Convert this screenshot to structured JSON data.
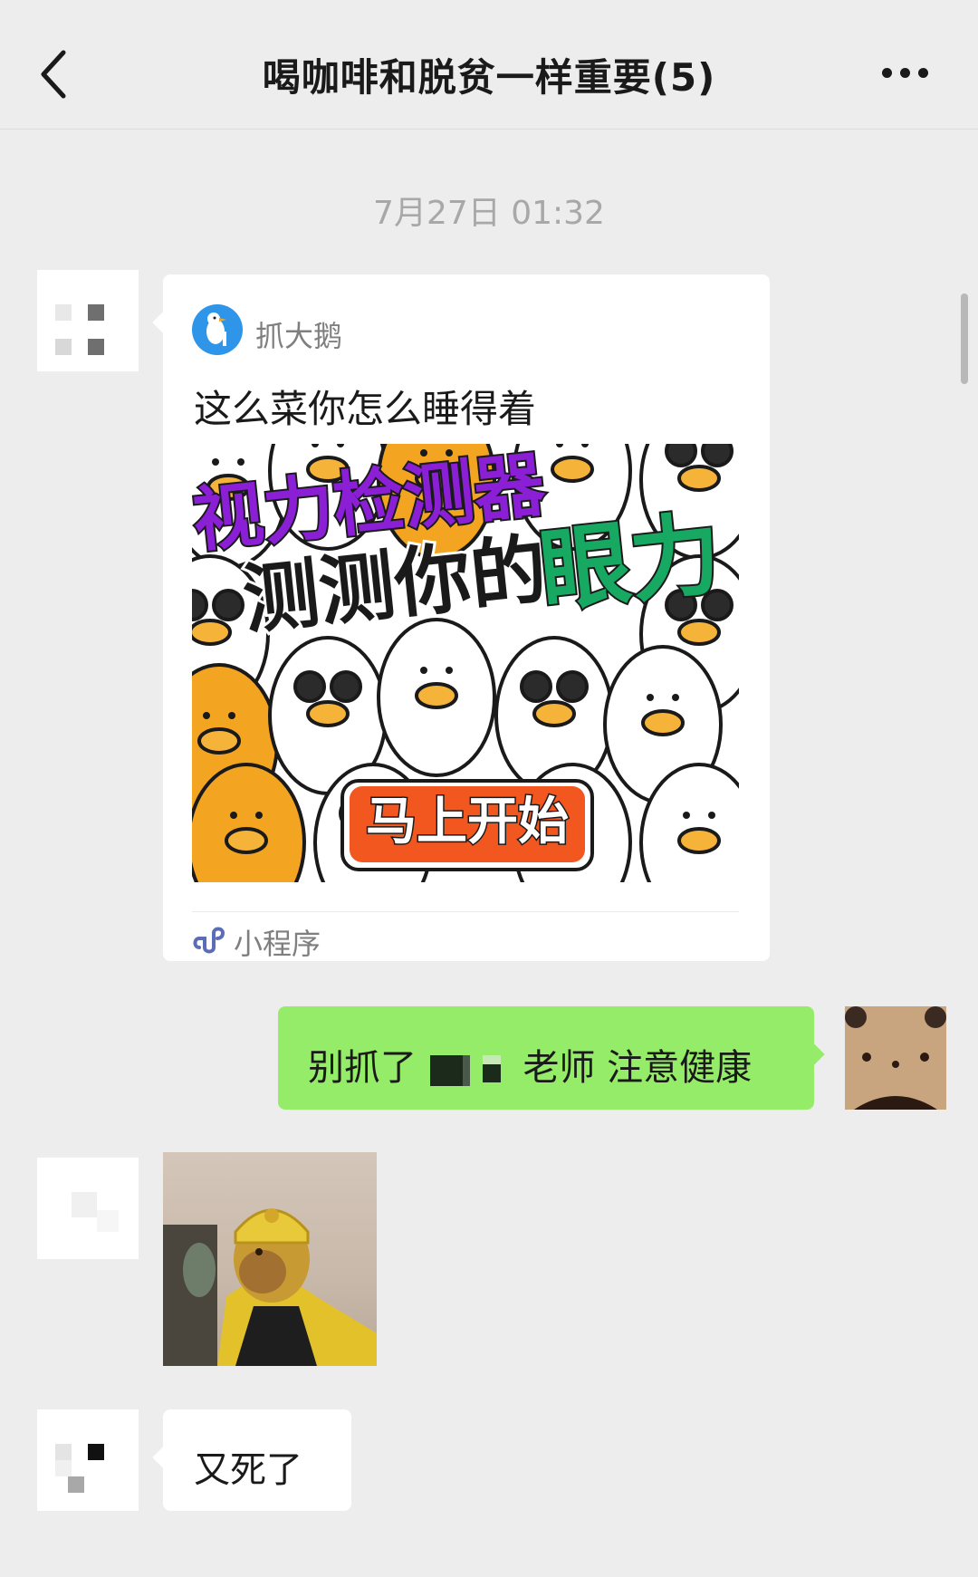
{
  "header": {
    "title": "喝咖啡和脱贫一样重要(5)",
    "back_icon": "chevron-left-icon",
    "more_icon": "ellipsis-icon"
  },
  "timestamp": "7月27日 01:32",
  "messages": [
    {
      "type": "mini_program",
      "sender": "other",
      "app_name": "抓大鹅",
      "description": "这么菜你怎么睡得着",
      "image": {
        "headline_1": "视力检测器",
        "headline_2": "测测你的",
        "headline_3": "眼力",
        "cta": "马上开始"
      },
      "footer_label": "小程序",
      "footer_icon": "mini-program-icon"
    },
    {
      "type": "text",
      "sender": "me",
      "text_before": "别抓了",
      "text_after": "老师 注意健康"
    },
    {
      "type": "sticker",
      "sender": "other",
      "depiction": "monkey-king-sticker"
    },
    {
      "type": "text",
      "sender": "other",
      "text": "又死了"
    }
  ],
  "colors": {
    "background": "#ededed",
    "bubble_me": "#95ec69",
    "bubble_other": "#ffffff",
    "headline_purple": "#8b1fd6",
    "headline_green": "#17a862",
    "cta_orange": "#f2571f"
  }
}
